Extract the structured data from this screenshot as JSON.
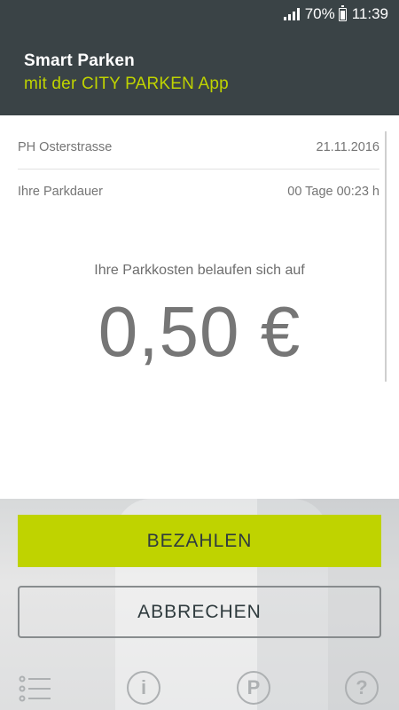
{
  "status_bar": {
    "battery": "70%",
    "time": "11:39"
  },
  "header": {
    "title": "Smart Parken",
    "subtitle": "mit der CITY PARKEN App"
  },
  "parking": {
    "location": "PH Osterstrasse",
    "date": "21.11.2016",
    "duration_label": "Ihre Parkdauer",
    "duration_value": "00 Tage 00:23 h",
    "cost_label": "Ihre Parkkosten belaufen sich auf",
    "cost_value": "0,50 €"
  },
  "actions": {
    "pay_label": "BEZAHLEN",
    "cancel_label": "ABBRECHEN"
  },
  "nav": {
    "items": [
      {
        "icon": "list-icon"
      },
      {
        "icon": "info-icon",
        "glyph": "i"
      },
      {
        "icon": "parking-icon",
        "glyph": "P"
      },
      {
        "icon": "help-icon",
        "glyph": "?"
      }
    ]
  },
  "colors": {
    "header_bg": "#3a4346",
    "accent": "#bfd300",
    "text_gray": "#767676"
  }
}
